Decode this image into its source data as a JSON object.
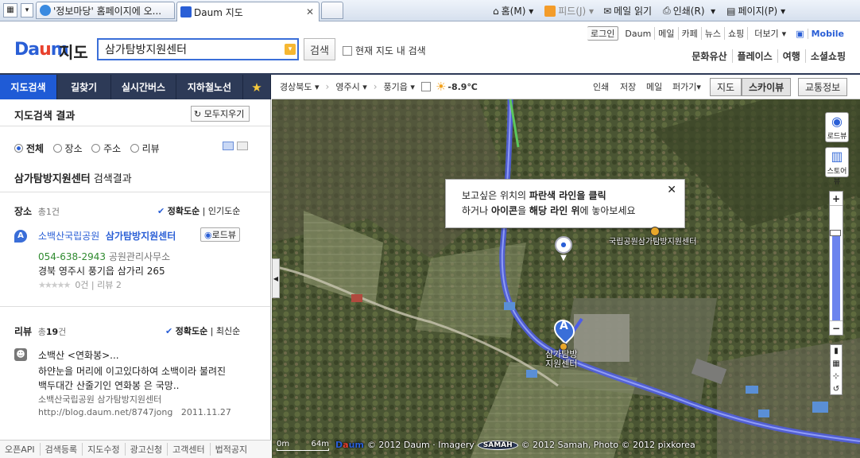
{
  "browser": {
    "tabs": [
      {
        "label": "'정보마당' 홈페이지에 오..."
      },
      {
        "label": "Daum 지도"
      }
    ],
    "toolbar": {
      "home": "홈(M)",
      "feeds": "피드(J)",
      "mail": "메일 읽기",
      "print": "인쇄(R)",
      "page": "페이지(P)"
    }
  },
  "header": {
    "logo": {
      "d": "D",
      "a": "a",
      "u": "u",
      "m": "m"
    },
    "title": "지도",
    "search": {
      "value": "삼가탐방지원센터",
      "button": "검색"
    },
    "current_map_search": "현재 지도 내 검색",
    "topnav": [
      "로그인",
      "Daum",
      "메일",
      "카페",
      "뉴스",
      "쇼핑",
      "더보기"
    ],
    "mobile": "Mobile",
    "subnav": [
      "문화유산",
      "플레이스",
      "여행",
      "소셜쇼핑"
    ]
  },
  "left": {
    "tabs": [
      "지도검색",
      "길찾기",
      "실시간버스",
      "지하철노선"
    ],
    "result_title": "지도검색 결과",
    "clear_all": "모두지우기",
    "filters": [
      "전체",
      "장소",
      "주소",
      "리뷰"
    ],
    "query_heading": {
      "query": "삼가탐방지원센터",
      "suffix": " 검색결과"
    },
    "places": {
      "label": "장소",
      "count_prefix": "총",
      "count": "1",
      "count_suffix": "건",
      "sort_accuracy": "정확도순",
      "sort_popular": "인기도순",
      "item": {
        "marker": "A",
        "prefix": "소백산국립공원",
        "name": "삼가탐방지원센터",
        "roadview": "로드뷰",
        "phone": "054-638-2943",
        "org": "공원관리사무소",
        "address": "경북 영주시 풍기읍 삼가리 265",
        "rating": "0건",
        "review": "리뷰 2"
      }
    },
    "reviews": {
      "label": "리뷰",
      "count_prefix": "총",
      "count": "19",
      "count_suffix": "건",
      "sort_accuracy": "정확도순",
      "sort_latest": "최신순",
      "item": {
        "title": "소백산 <연화봉>...",
        "line1": "하얀눈을 머리에 이고있다하여 소백이라 불려진",
        "line2": "백두대간 산줄기인 연화봉 은 국망..",
        "source": "소백산국립공원 삼가탐방지원센터",
        "url": "http://blog.daum.net/8747jong",
        "date": "2011.11.27"
      }
    },
    "footer": [
      "오픈API",
      "검색등록",
      "지도수정",
      "광고신청",
      "고객센터",
      "법적공지"
    ]
  },
  "map": {
    "breadcrumb": [
      "경상북도",
      "영주시",
      "풍기읍"
    ],
    "weather": "-8.9℃",
    "tools": [
      "인쇄",
      "저장",
      "메일",
      "퍼가기"
    ],
    "view_map": "지도",
    "view_sky": "스카이뷰",
    "traffic": "교통정보",
    "roadview_btn": "로드뷰",
    "storeview_btn": "스토어뷰",
    "bubble": {
      "l1a": "보고싶은 위치의 ",
      "l1b": "파란색 라인",
      "l1c": "을 클릭",
      "l2a": "하거나 ",
      "l2b": "아이콘",
      "l2c": "을 ",
      "l2d": "해당 라인 위",
      "l2e": "에 놓아보세요"
    },
    "poi_label": "국립공원삼가탐방지원센터",
    "marker": "A",
    "marker_label1": "삼가탐방",
    "marker_label2": "지원센터",
    "scale_0": "0m",
    "scale_64": "64m",
    "copyright": "© 2012 Daum · Imagery",
    "samah": "SAMAH",
    "copyright2": "© 2012 Samah, Photo © 2012 pixkorea"
  }
}
